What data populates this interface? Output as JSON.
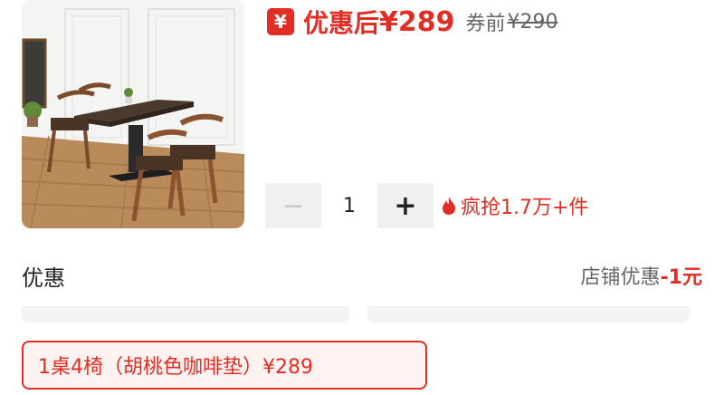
{
  "price": {
    "coupon_icon": "¥",
    "after_label": "优惠后",
    "after_value": "¥289",
    "before_label": "券前",
    "before_value": "¥290"
  },
  "quantity": {
    "minus": "−",
    "value": "1",
    "plus": "+"
  },
  "sales": {
    "icon": "flame-icon",
    "text": "疯抢1.7万+件"
  },
  "discount": {
    "title": "优惠",
    "store_label": "店铺优惠",
    "amount": "-1元"
  },
  "sku": {
    "selected_label": "1桌4椅（胡桃色咖啡垫）¥289"
  },
  "colors": {
    "accent": "#e02e24",
    "muted": "#666666",
    "stepper_bg": "#f0f0f0"
  }
}
